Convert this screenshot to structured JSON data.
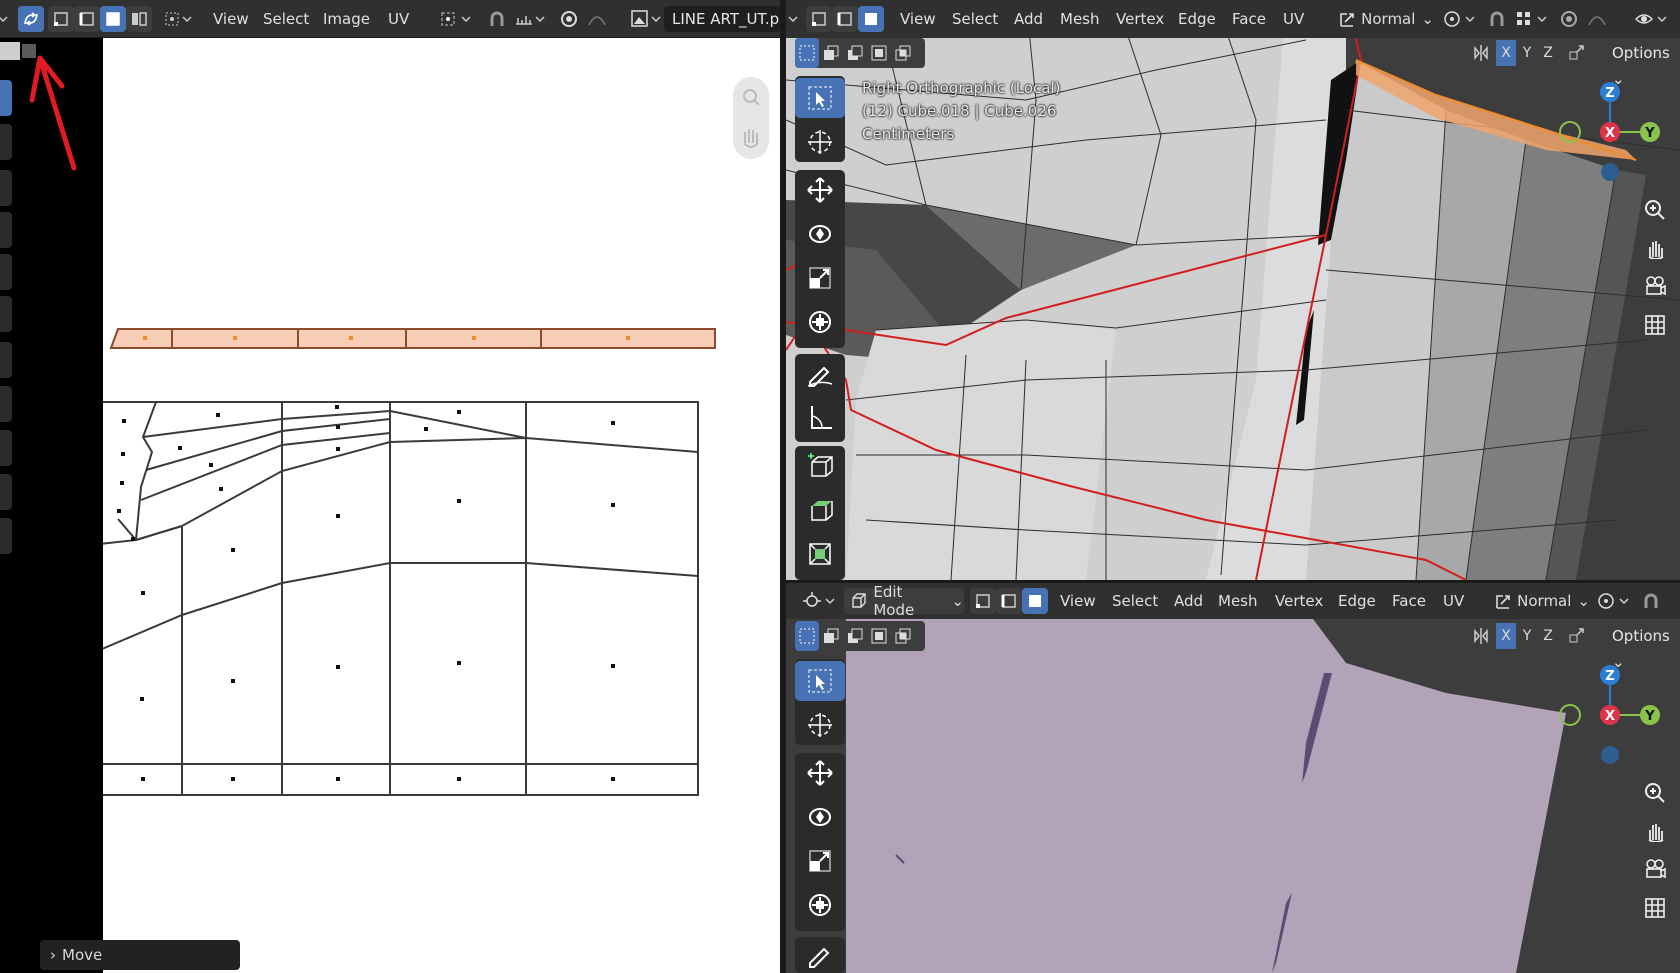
{
  "uv_editor": {
    "menus": [
      "View",
      "Select",
      "Image",
      "UV"
    ],
    "image_name": "LINE ART_UT.p",
    "last_operator": "Move"
  },
  "viewport_top": {
    "menus": [
      "View",
      "Select",
      "Add",
      "Mesh",
      "Vertex",
      "Edge",
      "Face",
      "UV"
    ],
    "orientation": "Normal",
    "view_name": "Right Orthographic (Local)",
    "object_info": "(12) Cube.018 | Cube.026",
    "units": "Centimeters",
    "axes": [
      "X",
      "Y",
      "Z"
    ],
    "options_label": "Options"
  },
  "viewport_bottom": {
    "mode": "Edit Mode",
    "menus": [
      "View",
      "Select",
      "Add",
      "Mesh",
      "Vertex",
      "Edge",
      "Face",
      "UV"
    ],
    "orientation": "Normal",
    "axes": [
      "X",
      "Y",
      "Z"
    ],
    "options_label": "Options"
  },
  "gizmo": {
    "z": "Z",
    "x": "X",
    "y": "Y"
  },
  "colors": {
    "accent": "#4772b3",
    "selected_uv": "#f8cdb6",
    "selected_edge": "#f08c2c",
    "seam": "#d21e1e",
    "mesh_face": "#b2a3b8"
  }
}
